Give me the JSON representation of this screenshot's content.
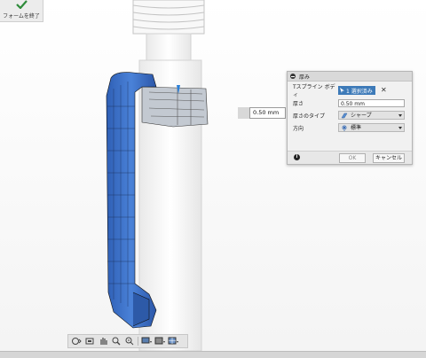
{
  "toolbar": {
    "finish_form_label": "フォームを終了"
  },
  "floating_input": {
    "value": "0.50 mm"
  },
  "dialog": {
    "title": "厚み",
    "rows": {
      "body_label": "Tスプライン ボディ",
      "body_selection": "1 選択済み",
      "thickness_label": "厚さ",
      "thickness_value": "0.50 mm",
      "type_label": "厚さのタイプ",
      "type_value": "シャープ",
      "direction_label": "方向",
      "direction_value": "標準"
    },
    "ok_label": "OK",
    "cancel_label": "キャンセル"
  },
  "navbar": {
    "icons": [
      "orbit-icon",
      "look-at-icon",
      "pan-icon",
      "zoom-icon",
      "fit-icon",
      "display-settings-icon",
      "visual-style-icon",
      "grid-icon"
    ]
  },
  "colors": {
    "accent": "#3d7ab8",
    "model_blue": "#3f72c8"
  }
}
